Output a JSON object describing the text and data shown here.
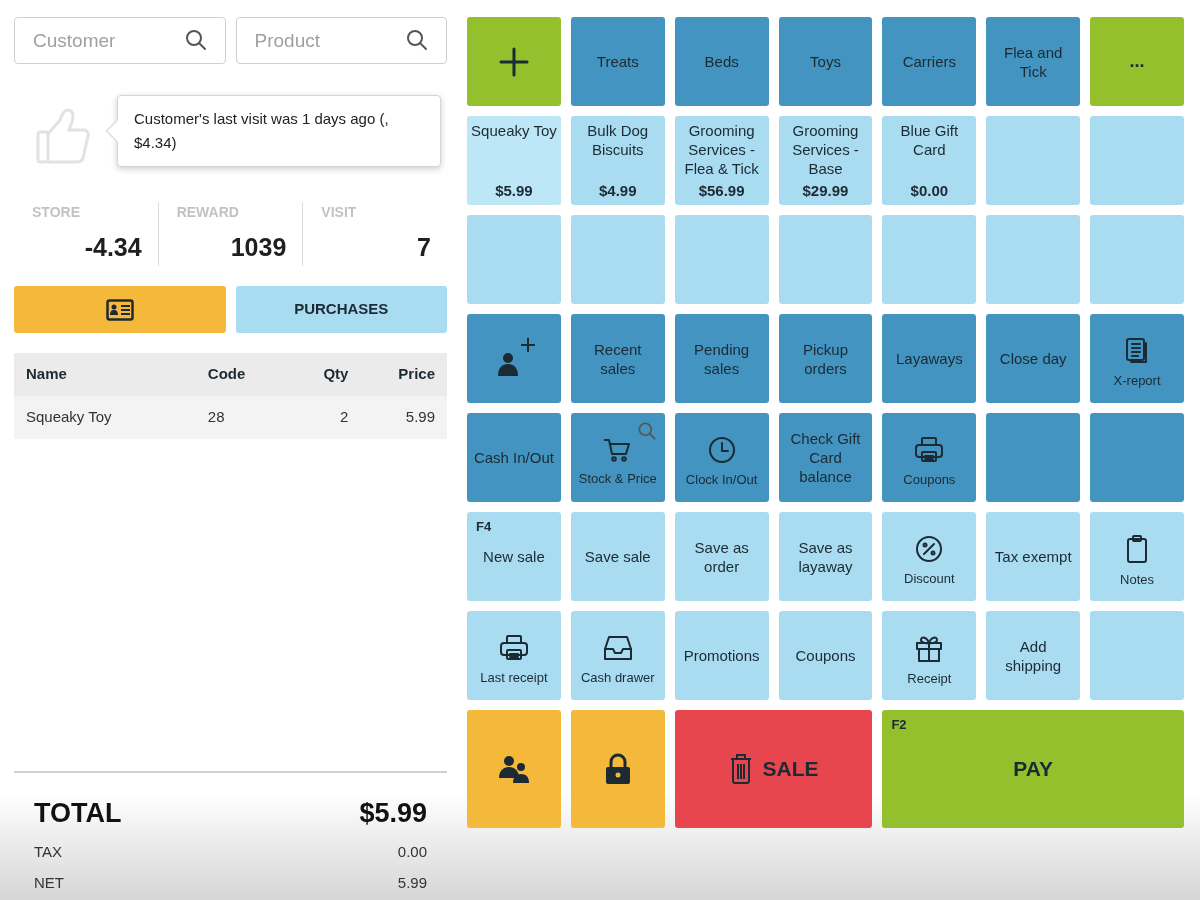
{
  "search": [
    {
      "placeholder": "Customer"
    },
    {
      "placeholder": "Product"
    }
  ],
  "tooltip": "Customer's last visit was 1 days ago (, $4.34)",
  "stats": [
    {
      "label": "STORE",
      "value": "-4.34"
    },
    {
      "label": "REWARD",
      "value": "1039"
    },
    {
      "label": "VISIT",
      "value": "7"
    }
  ],
  "purchases_button": "PURCHASES",
  "table": {
    "columns": [
      "Name",
      "Code",
      "Qty",
      "Price"
    ],
    "rows": [
      [
        "Squeaky Toy",
        "28",
        "2",
        "5.99"
      ]
    ]
  },
  "totals": {
    "total_label": "TOTAL",
    "total": "$5.99",
    "lines": [
      {
        "label": "TAX",
        "value": "0.00"
      },
      {
        "label": "NET",
        "value": "5.99"
      }
    ]
  },
  "tiles": [
    {
      "kind": "add",
      "color": "#93c02c"
    },
    {
      "kind": "category",
      "label": "Treats",
      "color": "#4394c0"
    },
    {
      "kind": "category",
      "label": "Beds",
      "color": "#4394c0"
    },
    {
      "kind": "category",
      "label": "Toys",
      "color": "#4394c0"
    },
    {
      "kind": "category",
      "label": "Carriers",
      "color": "#4394c0"
    },
    {
      "kind": "category",
      "label": "Flea and Tick",
      "color": "#4394c0"
    },
    {
      "kind": "more",
      "label": "...",
      "color": "#93c02c"
    },
    {
      "kind": "product",
      "label": "Squeaky Toy",
      "price": "$5.99",
      "color": "#bde6f6"
    },
    {
      "kind": "product",
      "label": "Bulk Dog Biscuits",
      "price": "$4.99",
      "color": "#a9dcf1"
    },
    {
      "kind": "product",
      "label": "Grooming Services - Flea & Tick",
      "price": "$56.99",
      "color": "#a9dcf1"
    },
    {
      "kind": "product",
      "label": "Grooming Services - Base",
      "price": "$29.99",
      "color": "#a9dcf1"
    },
    {
      "kind": "product",
      "label": "Blue Gift Card",
      "price": "$0.00",
      "color": "#a9dcf1"
    },
    {
      "kind": "empty",
      "color": "#a9dcf1"
    },
    {
      "kind": "empty",
      "color": "#a9dcf1"
    },
    {
      "kind": "empty",
      "color": "#a9dcf1"
    },
    {
      "kind": "empty",
      "color": "#a9dcf1"
    },
    {
      "kind": "empty",
      "color": "#a9dcf1"
    },
    {
      "kind": "empty",
      "color": "#a9dcf1"
    },
    {
      "kind": "empty",
      "color": "#a9dcf1"
    },
    {
      "kind": "empty",
      "color": "#a9dcf1"
    },
    {
      "kind": "empty",
      "color": "#a9dcf1"
    },
    {
      "kind": "customer",
      "color": "#4394c0"
    },
    {
      "kind": "action",
      "label": "Recent sales",
      "color": "#4394c0"
    },
    {
      "kind": "action",
      "label": "Pending sales",
      "color": "#4394c0"
    },
    {
      "kind": "action",
      "label": "Pickup orders",
      "color": "#4394c0"
    },
    {
      "kind": "action",
      "label": "Layaways",
      "color": "#4394c0"
    },
    {
      "kind": "action",
      "label": "Close day",
      "color": "#4394c0"
    },
    {
      "kind": "report",
      "label": "X-report",
      "color": "#4394c0"
    },
    {
      "kind": "action",
      "label": "Cash In/Out",
      "color": "#4394c0"
    },
    {
      "kind": "stock",
      "label": "Stock & Price",
      "color": "#4394c0"
    },
    {
      "kind": "clock",
      "label": "Clock In/Out",
      "color": "#4394c0"
    },
    {
      "kind": "action",
      "label": "Check Gift Card balance",
      "color": "#4394c0"
    },
    {
      "kind": "printer",
      "label": "Coupons",
      "color": "#4394c0"
    },
    {
      "kind": "empty",
      "color": "#4394c0"
    },
    {
      "kind": "empty",
      "color": "#4394c0"
    },
    {
      "kind": "action",
      "label": "New sale",
      "hotkey": "F4",
      "color": "#a9dcf1"
    },
    {
      "kind": "action",
      "label": "Save sale",
      "color": "#a9dcf1"
    },
    {
      "kind": "action",
      "label": "Save as order",
      "color": "#a9dcf1"
    },
    {
      "kind": "action",
      "label": "Save as layaway",
      "color": "#a9dcf1"
    },
    {
      "kind": "discount",
      "label": "Discount",
      "color": "#a9dcf1"
    },
    {
      "kind": "action",
      "label": "Tax exempt",
      "color": "#a9dcf1"
    },
    {
      "kind": "notes",
      "label": "Notes",
      "color": "#a9dcf1"
    },
    {
      "kind": "printer",
      "label": "Last receipt",
      "color": "#a9dcf1"
    },
    {
      "kind": "drawer",
      "label": "Cash drawer",
      "color": "#a9dcf1"
    },
    {
      "kind": "action",
      "label": "Promotions",
      "color": "#a9dcf1"
    },
    {
      "kind": "action",
      "label": "Coupons",
      "color": "#a9dcf1"
    },
    {
      "kind": "gift",
      "label": "Receipt",
      "color": "#a9dcf1"
    },
    {
      "kind": "action",
      "label": "Add shipping",
      "color": "#a9dcf1"
    },
    {
      "kind": "empty",
      "color": "#a9dcf1"
    },
    {
      "kind": "group",
      "color": "#f4b83a"
    },
    {
      "kind": "lock",
      "color": "#f4b83a"
    },
    {
      "kind": "void",
      "label": "SALE",
      "color": "#e8464f"
    },
    {
      "kind": "pay",
      "label": "PAY",
      "hotkey": "F2",
      "color": "#93c02c"
    }
  ]
}
